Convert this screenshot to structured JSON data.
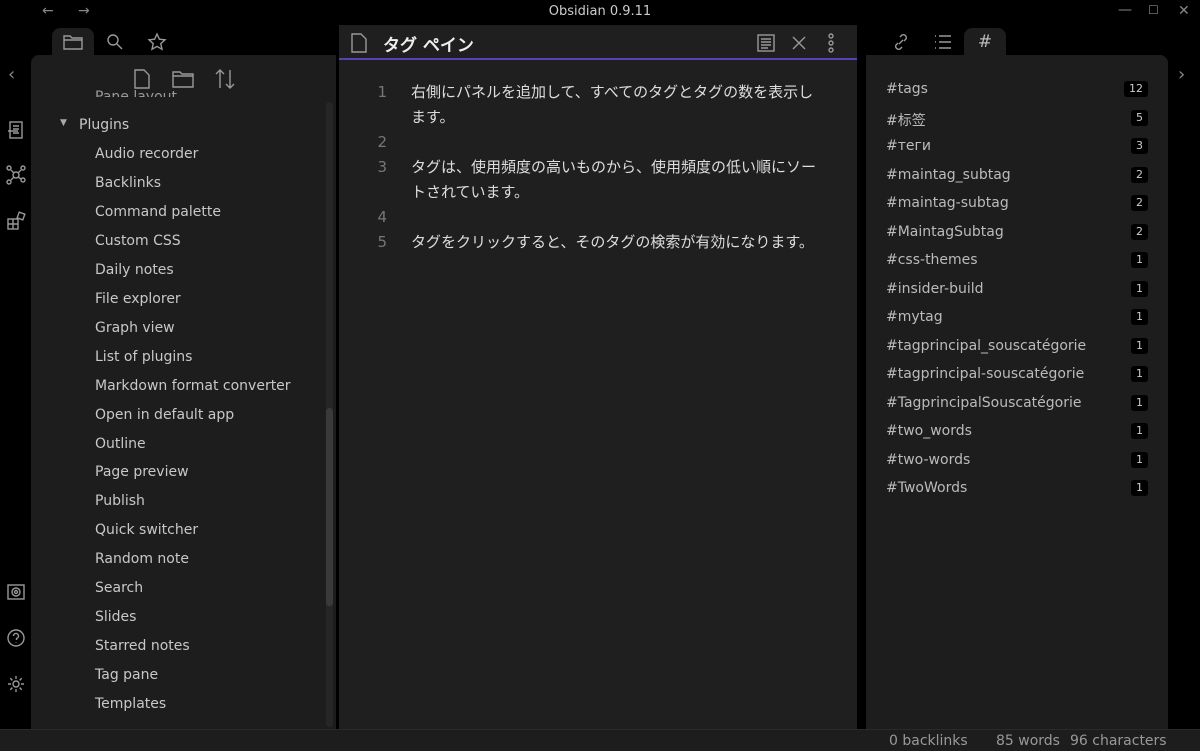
{
  "window": {
    "title": "Obsidian 0.9.11"
  },
  "left_panel": {
    "partial_item": "Pane layout",
    "folder": "Plugins",
    "items": [
      "Audio recorder",
      "Backlinks",
      "Command palette",
      "Custom CSS",
      "Daily notes",
      "File explorer",
      "Graph view",
      "List of plugins",
      "Markdown format converter",
      "Open in default app",
      "Outline",
      "Page preview",
      "Publish",
      "Quick switcher",
      "Random note",
      "Search",
      "Slides",
      "Starred notes",
      "Tag pane",
      "Templates"
    ]
  },
  "editor": {
    "title": "タグ ペイン",
    "lines": [
      {
        "num": "1",
        "text": "右側にパネルを追加して、すべてのタグとタグの数を表示します。"
      },
      {
        "num": "2",
        "text": ""
      },
      {
        "num": "3",
        "text": "タグは、使用頻度の高いものから、使用頻度の低い順にソートされています。"
      },
      {
        "num": "4",
        "text": ""
      },
      {
        "num": "5",
        "text": "タグをクリックすると、そのタグの検索が有効になります。"
      }
    ]
  },
  "tag_pane": {
    "tags": [
      {
        "name": "#tags",
        "count": "12"
      },
      {
        "name": "#标签",
        "count": "5"
      },
      {
        "name": "#теги",
        "count": "3"
      },
      {
        "name": "#maintag_subtag",
        "count": "2"
      },
      {
        "name": "#maintag-subtag",
        "count": "2"
      },
      {
        "name": "#MaintagSubtag",
        "count": "2"
      },
      {
        "name": "#css-themes",
        "count": "1"
      },
      {
        "name": "#insider-build",
        "count": "1"
      },
      {
        "name": "#mytag",
        "count": "1"
      },
      {
        "name": "#tagprincipal_souscatégorie",
        "count": "1"
      },
      {
        "name": "#tagprincipal-souscatégorie",
        "count": "1"
      },
      {
        "name": "#TagprincipalSouscatégorie",
        "count": "1"
      },
      {
        "name": "#two_words",
        "count": "1"
      },
      {
        "name": "#two-words",
        "count": "1"
      },
      {
        "name": "#TwoWords",
        "count": "1"
      }
    ]
  },
  "status": {
    "backlinks": "0 backlinks",
    "words": "85 words",
    "characters": "96 characters"
  },
  "colors": {
    "accent": "#5b40b4"
  }
}
